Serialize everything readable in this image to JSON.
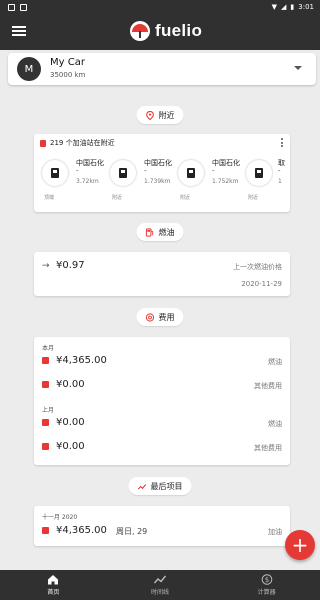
{
  "status_bar": {
    "time": "3:01"
  },
  "app": {
    "name": "fuelio"
  },
  "vehicle": {
    "avatar_letter": "M",
    "name": "My Car",
    "odometer": "35000 km"
  },
  "sections": {
    "nearby": {
      "label": "附近"
    },
    "fuel": {
      "label": "燃油"
    },
    "costs": {
      "label": "费用"
    },
    "recent": {
      "label": "最后项目"
    }
  },
  "nearby_card": {
    "header": "219 个加油站在附近",
    "stations": [
      {
        "name": "中国石化",
        "sub": "-",
        "distance": "3.72km",
        "tag": "顶端"
      },
      {
        "name": "中国石化",
        "sub": "-",
        "distance": "1.739km",
        "tag": "附近"
      },
      {
        "name": "中国石化",
        "sub": "-",
        "distance": "1.752km",
        "tag": "附近"
      },
      {
        "name": "取",
        "sub": "-",
        "distance": "1",
        "tag": "附近"
      }
    ]
  },
  "fuel_card": {
    "arrow": "→",
    "price": "¥0.97",
    "label": "上一次燃油价格",
    "date": "2020-11-29"
  },
  "cost_card": {
    "this_month": {
      "label": "本月",
      "rows": [
        {
          "value": "¥4,365.00",
          "type": "燃油"
        },
        {
          "value": "¥0.00",
          "type": "其他费用"
        }
      ]
    },
    "last_month": {
      "label": "上月",
      "rows": [
        {
          "value": "¥0.00",
          "type": "燃油"
        },
        {
          "value": "¥0.00",
          "type": "其他费用"
        }
      ]
    }
  },
  "last_item": {
    "month": "十一月 2020",
    "value": "¥4,365.00",
    "day": "周日, 29",
    "type": "加油"
  },
  "fab": {
    "label": "+"
  },
  "bottom_nav": {
    "items": [
      {
        "label": "首页"
      },
      {
        "label": "时间线"
      },
      {
        "label": "计算器"
      }
    ]
  },
  "colors": {
    "accent": "#e53935",
    "bar": "#303030",
    "background": "#ececec"
  }
}
